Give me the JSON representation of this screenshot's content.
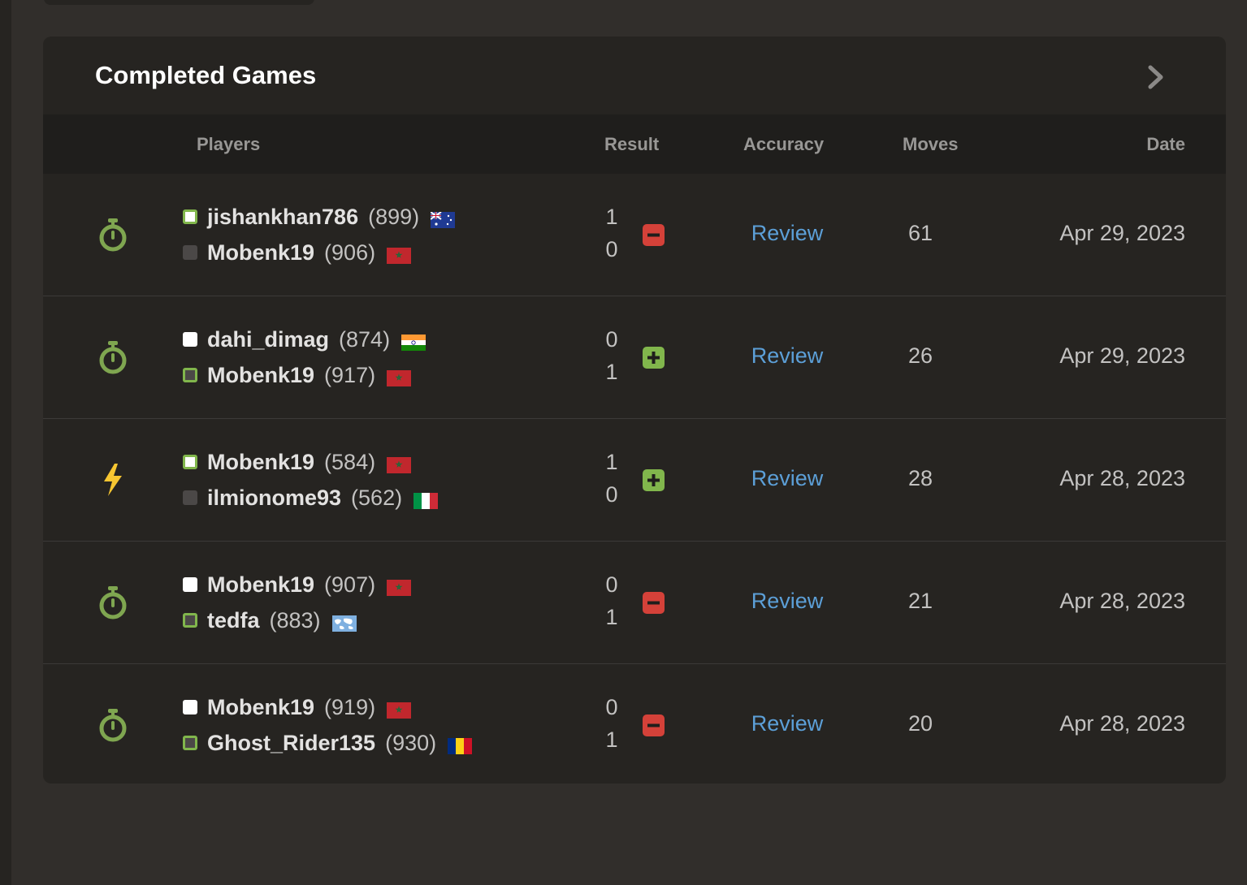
{
  "panel": {
    "title": "Completed Games",
    "columns": {
      "players": "Players",
      "result": "Result",
      "accuracy": "Accuracy",
      "moves": "Moves",
      "date": "Date"
    }
  },
  "games": [
    {
      "type_icon": "stopwatch-icon",
      "white": {
        "name": "jishankhan786",
        "rating": "(899)",
        "flag": "australia-flag",
        "won": true
      },
      "black": {
        "name": "Mobenk19",
        "rating": "(906)",
        "flag": "morocco-flag",
        "won": false
      },
      "score_white": "1",
      "score_black": "0",
      "result_icon": "loss-icon",
      "accuracy": "Review",
      "moves": "61",
      "date": "Apr 29, 2023"
    },
    {
      "type_icon": "stopwatch-icon",
      "white": {
        "name": "dahi_dimag",
        "rating": "(874)",
        "flag": "india-flag",
        "won": false
      },
      "black": {
        "name": "Mobenk19",
        "rating": "(917)",
        "flag": "morocco-flag",
        "won": true
      },
      "score_white": "0",
      "score_black": "1",
      "result_icon": "win-icon",
      "accuracy": "Review",
      "moves": "26",
      "date": "Apr 29, 2023"
    },
    {
      "type_icon": "lightning-icon",
      "white": {
        "name": "Mobenk19",
        "rating": "(584)",
        "flag": "morocco-flag",
        "won": true
      },
      "black": {
        "name": "ilmionome93",
        "rating": "(562)",
        "flag": "italy-flag",
        "won": false
      },
      "score_white": "1",
      "score_black": "0",
      "result_icon": "win-icon",
      "accuracy": "Review",
      "moves": "28",
      "date": "Apr 28, 2023"
    },
    {
      "type_icon": "stopwatch-icon",
      "white": {
        "name": "Mobenk19",
        "rating": "(907)",
        "flag": "morocco-flag",
        "won": false
      },
      "black": {
        "name": "tedfa",
        "rating": "(883)",
        "flag": "world-flag",
        "won": true
      },
      "score_white": "0",
      "score_black": "1",
      "result_icon": "loss-icon",
      "accuracy": "Review",
      "moves": "21",
      "date": "Apr 28, 2023"
    },
    {
      "type_icon": "stopwatch-icon",
      "white": {
        "name": "Mobenk19",
        "rating": "(919)",
        "flag": "morocco-flag",
        "won": false
      },
      "black": {
        "name": "Ghost_Rider135",
        "rating": "(930)",
        "flag": "romania-flag",
        "won": true
      },
      "score_white": "0",
      "score_black": "1",
      "result_icon": "loss-icon",
      "accuracy": "Review",
      "moves": "20",
      "date": "Apr 28, 2023"
    }
  ],
  "colors": {
    "win": "#81b64c",
    "loss": "#d44139",
    "link": "#5c9fd7",
    "lightning": "#f7c631"
  }
}
